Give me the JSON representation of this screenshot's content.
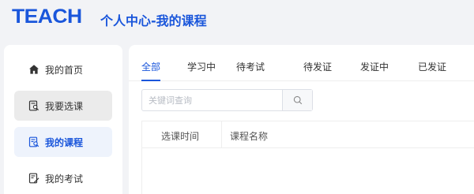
{
  "header": {
    "logo_text": "TEACH",
    "title": "个人中心-我的课程"
  },
  "sidebar": {
    "items": [
      {
        "label": "我的首页",
        "icon": "home-icon"
      },
      {
        "label": "我要选课",
        "icon": "course-search-icon"
      },
      {
        "label": "我的课程",
        "icon": "my-courses-icon"
      },
      {
        "label": "我的考试",
        "icon": "exam-icon"
      }
    ],
    "active_index": 2,
    "hover_index": 1
  },
  "tabs": {
    "items": [
      "全部",
      "学习中",
      "待考试",
      "待发证",
      "发证中",
      "已发证"
    ],
    "active_index": 0
  },
  "search": {
    "placeholder": "关键词查询",
    "icon": "search-icon"
  },
  "table": {
    "columns": [
      "选课时间",
      "课程名称"
    ],
    "rows": []
  },
  "colors": {
    "accent": "#1a56db",
    "page_bg": "#f2f3f6",
    "active_bg": "#eef3fc",
    "hover_bg": "#ebebeb"
  }
}
